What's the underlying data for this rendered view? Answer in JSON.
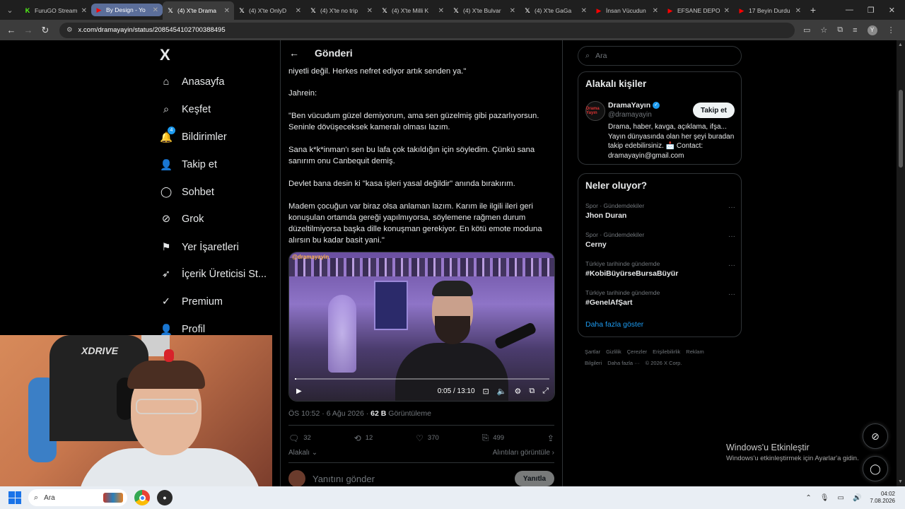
{
  "browser": {
    "tabs": [
      {
        "label": "FuruGO Stream",
        "icon": "kick-icon",
        "color": "#53fc18"
      },
      {
        "label": "By Design - Yo",
        "icon": "youtube-icon",
        "color": "#ff0000"
      },
      {
        "label": "(4) X'te Drama",
        "icon": "x-icon",
        "color": "#ffffff"
      },
      {
        "label": "(4) X'te OnlyD",
        "icon": "x-icon",
        "color": "#ffffff"
      },
      {
        "label": "(4) X'te no trip",
        "icon": "x-icon",
        "color": "#ffffff"
      },
      {
        "label": "(4) X'te Milli K",
        "icon": "x-icon",
        "color": "#ffffff"
      },
      {
        "label": "(4) X'te Bulvar",
        "icon": "x-icon",
        "color": "#ffffff"
      },
      {
        "label": "(4) X'te GaGa",
        "icon": "x-icon",
        "color": "#ffffff"
      },
      {
        "label": "İnsan Vücudun",
        "icon": "youtube-icon",
        "color": "#ff0000"
      },
      {
        "label": "EFSANE DEPO",
        "icon": "youtube-icon",
        "color": "#ff0000"
      },
      {
        "label": "17 Beyin Durdu",
        "icon": "youtube-icon",
        "color": "#ff0000"
      }
    ],
    "url": "x.com/dramayayin/status/2085454102700388495"
  },
  "nav": {
    "logo": "X",
    "items": [
      {
        "label": "Anasayfa",
        "icon": "home-icon"
      },
      {
        "label": "Keşfet",
        "icon": "search-icon"
      },
      {
        "label": "Bildirimler",
        "icon": "bell-icon",
        "badge": "4"
      },
      {
        "label": "Takip et",
        "icon": "follow-icon"
      },
      {
        "label": "Sohbet",
        "icon": "chat-icon"
      },
      {
        "label": "Grok",
        "icon": "grok-icon"
      },
      {
        "label": "Yer İşaretleri",
        "icon": "bookmark-icon"
      },
      {
        "label": "İçerik Üreticisi St...",
        "icon": "rocket-icon"
      },
      {
        "label": "Premium",
        "icon": "premium-icon"
      },
      {
        "label": "Profil",
        "icon": "profile-icon"
      }
    ]
  },
  "post": {
    "header": "Gönderi",
    "paragraphs": [
      "niyetli değil. Herkes nefret ediyor artık senden ya.\"",
      "Jahrein:",
      "\"Ben vücudum güzel demiyorum, ama sen güzelmiş gibi pazarlıyorsun. Seninle dövüşeceksek kameralı olması lazım.",
      "Sana k*k*inman'ı sen bu lafa çok takıldığın için söyledim. Çünkü sana sanırım onu Canbequit demiş.",
      "Devlet bana desin ki \"kasa işleri yasal değildir\" anında bırakırım.",
      "Madem çocuğun var biraz olsa anlaman lazım. Karım ile ilgili ileri geri konuşulan ortamda gereği yapılmıyorsa, söylemene rağmen durum düzeltilmiyorsa başka dille konuşman gerekiyor. En kötü emote moduna alırsın bu kadar basit yani.\""
    ],
    "video": {
      "tag": "@dramayayin",
      "time": "0:05 / 13:10",
      "progress": 0.006
    },
    "meta_time": "ÖS 10:52 · 6 Ağu 2026 · ",
    "meta_views": "62 B",
    "meta_views_label": " Görüntüleme",
    "actions": {
      "replies": "32",
      "reposts": "12",
      "likes": "370",
      "bookmarks": "499"
    },
    "related_label": "Alakalı",
    "quotes_label": "Alıntıları görüntüle",
    "reply_placeholder": "Yanıtını gönder",
    "reply_button": "Yanıtla"
  },
  "right": {
    "search_placeholder": "Ara",
    "people_title": "Alakalı kişiler",
    "person": {
      "name": "DramaYayın",
      "handle": "@dramayayin",
      "follow": "Takip et",
      "bio": "Drama, haber, kavga, açıklama, ifşa... Yayın dünyasında olan her şeyi buradan takip edebilirsiniz. 📩 Contact: dramayayin@gmail.com",
      "avatar_text": "Drama Yayın"
    },
    "trends_title": "Neler oluyor?",
    "trends": [
      {
        "category": "Spor · Gündemdekiler",
        "name": "Jhon Duran"
      },
      {
        "category": "Spor · Gündemdekiler",
        "name": "Cerny"
      },
      {
        "category": "Türkiye tarihinde gündemde",
        "name": "#KobiBüyürseBursaBüyür"
      },
      {
        "category": "Türkiye tarihinde gündemde",
        "name": "#GenelAfŞart"
      }
    ],
    "show_more": "Daha fazla göster",
    "footer": [
      "Şartlar",
      "Gizlilik",
      "Çerezler",
      "Erişilebilirlik",
      "Reklam Bilgileri",
      "Daha fazla ···",
      "© 2026 X Corp."
    ]
  },
  "watermark": {
    "line1": "Windows'u Etkinleştir",
    "line2": "Windows'u etkinleştirmek için Ayarlar'a gidin."
  },
  "webcam": {
    "chair_text": "XDRIVE"
  },
  "taskbar": {
    "search": "Ara",
    "time": "04:02",
    "date": "7.08.2026"
  }
}
